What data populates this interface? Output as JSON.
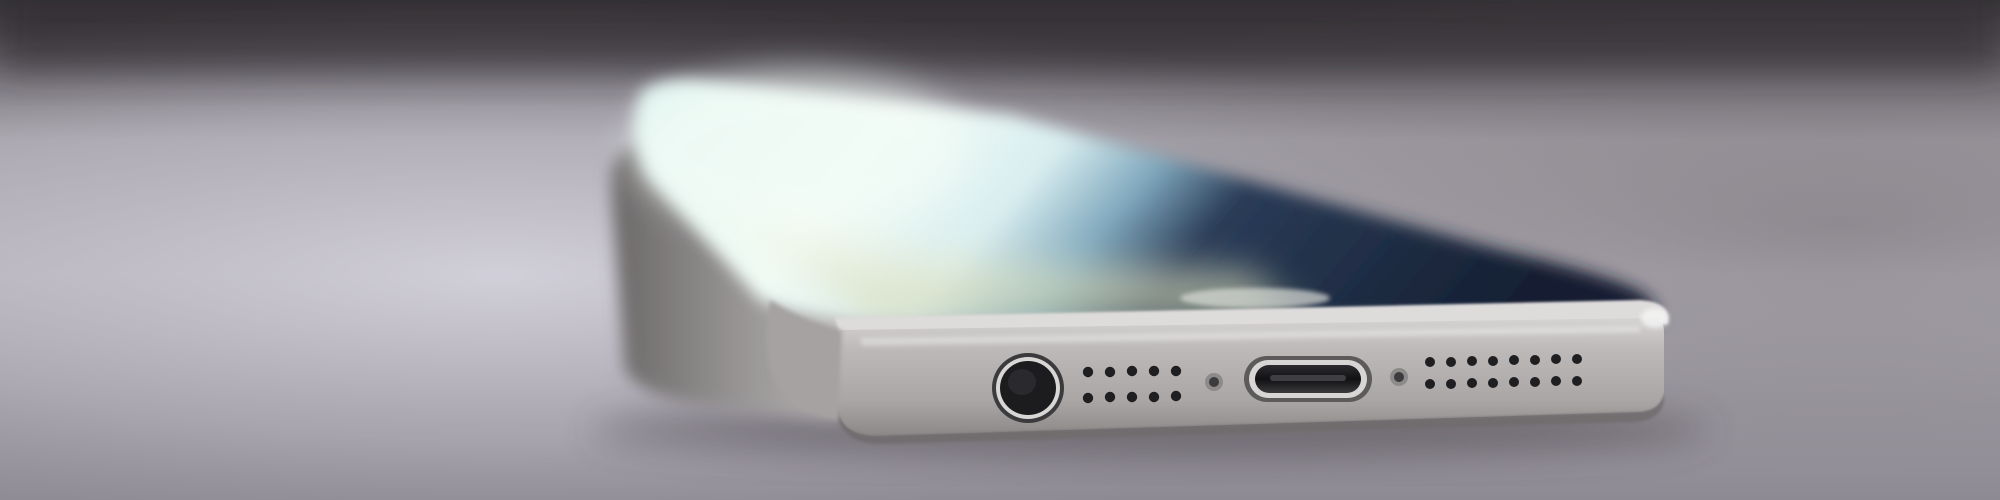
{
  "scene": {
    "subject": "smartphone",
    "colors": {
      "background_top": "#2d2a2e",
      "table_light": "#c9c6cd",
      "table_mid": "#a8a3aa",
      "table_dark": "#77737a",
      "table_bottom": "#8a8690",
      "phone_frame": "#b8b5b6",
      "phone_frame_dark": "#7f7b7d",
      "screen_glow": "#e7f7f3",
      "screen_dark": "#1b2a3f",
      "screen_tint": "#6fa7bf",
      "port_hole": "#1a1a1d"
    }
  }
}
